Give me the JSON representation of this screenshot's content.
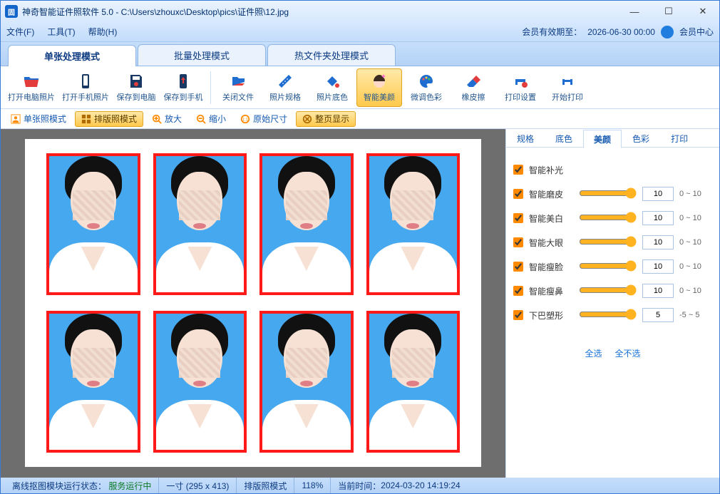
{
  "window": {
    "app_icon_text": "固",
    "title": "神奇智能证件照软件 5.0 - C:\\Users\\zhouxc\\Desktop\\pics\\证件照\\12.jpg"
  },
  "menu": {
    "file": "文件(F)",
    "tools": "工具(T)",
    "help": "帮助(H)",
    "membership_label": "会员有效期至：",
    "membership_date": "2026-06-30 00:00",
    "member_center": "会员中心"
  },
  "mode_tabs": {
    "single": "单张处理模式",
    "batch": "批量处理模式",
    "hotfolder": "热文件夹处理模式"
  },
  "toolbar": {
    "open_pc": "打开电脑照片",
    "open_phone": "打开手机照片",
    "save_pc": "保存到电脑",
    "save_phone": "保存到手机",
    "close_file": "关闭文件",
    "photo_spec": "照片规格",
    "photo_bg": "照片底色",
    "smart_beauty": "智能美颜",
    "color_adjust": "微调色彩",
    "eraser": "橡皮擦",
    "print_setup": "打印设置",
    "start_print": "开始打印"
  },
  "viewbar": {
    "single_mode": "单张照模式",
    "layout_mode": "排版照模式",
    "zoom_in": "放大",
    "zoom_out": "缩小",
    "original": "原始尺寸",
    "fit_page": "整页显示"
  },
  "panel": {
    "tabs": {
      "spec": "规格",
      "bg": "底色",
      "beauty": "美颜",
      "color": "色彩",
      "print": "打印"
    },
    "items": {
      "light": {
        "label": "智能补光",
        "value": null,
        "range": ""
      },
      "smooth": {
        "label": "智能磨皮",
        "value": "10",
        "range": "0 ~ 10"
      },
      "whiten": {
        "label": "智能美白",
        "value": "10",
        "range": "0 ~ 10"
      },
      "eye": {
        "label": "智能大眼",
        "value": "10",
        "range": "0 ~ 10"
      },
      "slim": {
        "label": "智能瘦脸",
        "value": "10",
        "range": "0 ~ 10"
      },
      "nose": {
        "label": "智能瘦鼻",
        "value": "10",
        "range": "0 ~ 10"
      },
      "chin": {
        "label": "下巴塑形",
        "value": "5",
        "range": "-5 ~ 5"
      }
    },
    "select_all": "全选",
    "select_none": "全不选"
  },
  "status": {
    "offline_label": "离线抠图模块运行状态：",
    "offline_value": "服务运行中",
    "size": "一寸 (295 x 413)",
    "mode": "排版照模式",
    "zoom": "118%",
    "time_label": "当前时间：",
    "time_value": "2024-03-20 14:19:24"
  }
}
